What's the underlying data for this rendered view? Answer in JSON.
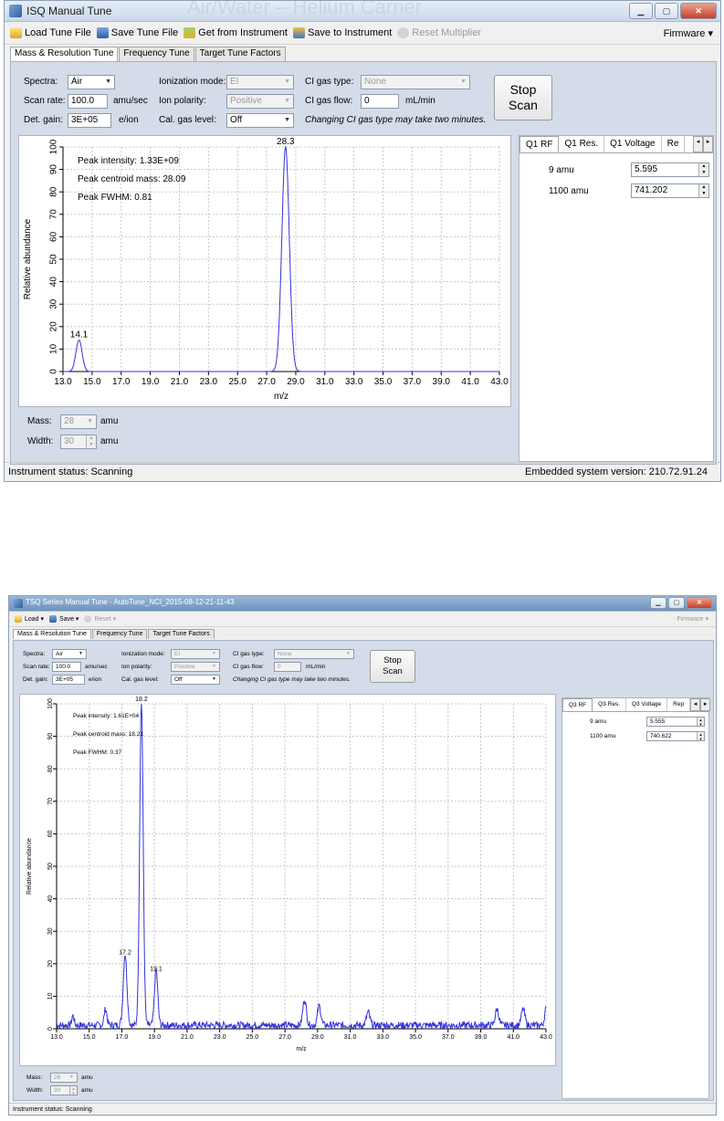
{
  "window1": {
    "title": "ISQ Manual Tune",
    "ghost_title": "Air/Water – Helium Carrier",
    "toolbar": {
      "load_label": "Load Tune File",
      "save_label": "Save Tune File",
      "get_label": "Get from Instrument",
      "save_instr_label": "Save to Instrument",
      "reset_label": "Reset Multiplier",
      "firmware_label": "Firmware ▾"
    },
    "tabs": [
      "Mass & Resolution Tune",
      "Frequency Tune",
      "Target Tune Factors"
    ],
    "controls": {
      "spectra_label": "Spectra:",
      "spectra_value": "Air",
      "scan_rate_label": "Scan rate:",
      "scan_rate_value": "100.0",
      "scan_rate_unit": "amu/sec",
      "det_gain_label": "Det. gain:",
      "det_gain_value": "3E+05",
      "det_gain_unit": "e/ion",
      "ion_mode_label": "Ionization mode:",
      "ion_mode_value": "EI",
      "ion_polarity_label": "Ion polarity:",
      "ion_polarity_value": "Positive",
      "cal_gas_label": "Cal. gas level:",
      "cal_gas_value": "Off",
      "ci_type_label": "CI gas type:",
      "ci_type_value": "None",
      "ci_flow_label": "CI gas flow:",
      "ci_flow_value": "0",
      "ci_flow_unit": "mL/min",
      "ci_note": "Changing CI gas type may take two minutes.",
      "stop_line1": "Stop",
      "stop_line2": "Scan"
    },
    "annotations": {
      "intensity": "Peak intensity: 1.33E+09",
      "centroid": "Peak centroid mass: 28.09",
      "fwhm": "Peak FWHM: 0.81"
    },
    "mass_label": "Mass:",
    "mass_value": "28",
    "mass_unit": "amu",
    "width_label": "Width:",
    "width_value": "30",
    "width_unit": "amu",
    "side": {
      "tabs": [
        "Q1 RF",
        "Q1 Res.",
        "Q1 Voltage",
        "Re"
      ],
      "rows": [
        {
          "label": "9 amu",
          "value": "5.595"
        },
        {
          "label": "1100 amu",
          "value": "741.202"
        }
      ]
    },
    "status_left": "Instrument status: Scanning",
    "status_right": "Embedded system version: 210.72.91.24"
  },
  "window2": {
    "title": "TSQ Series Manual Tune - AutoTune_NCI_2015-08-12-21-11-43",
    "toolbar": {
      "load_label": "Load ▾",
      "save_label": "Save ▾",
      "reset_label": "Reset ▾",
      "firmware_label": "Firmware ▾"
    },
    "tabs": [
      "Mass & Resolution Tune",
      "Frequency Tune",
      "Target Tune Factors"
    ],
    "controls": {
      "spectra_label": "Spectra:",
      "spectra_value": "Air",
      "scan_rate_label": "Scan rate:",
      "scan_rate_value": "100.0",
      "scan_rate_unit": "amu/sec",
      "det_gain_label": "Det. gain:",
      "det_gain_value": "3E+05",
      "det_gain_unit": "e/ion",
      "ion_mode_label": "Ionization mode:",
      "ion_mode_value": "EI",
      "ion_polarity_label": "Ion polarity:",
      "ion_polarity_value": "Positive",
      "cal_gas_label": "Cal. gas level:",
      "cal_gas_value": "Off",
      "ci_type_label": "CI gas type:",
      "ci_type_value": "None",
      "ci_flow_label": "CI gas flow:",
      "ci_flow_value": "0",
      "ci_flow_unit": "mL/min",
      "ci_note": "Changing CI gas type may take two minutes.",
      "stop_line1": "Stop",
      "stop_line2": "Scan"
    },
    "annotations": {
      "intensity": "Peak intensity: 1.61E+04",
      "centroid": "Peak centroid mass: 18.21",
      "fwhm": "Peak FWHM: 0.37"
    },
    "mass_label": "Mass:",
    "mass_value": "28",
    "mass_unit": "amu",
    "width_label": "Width:",
    "width_value": "30",
    "width_unit": "amu",
    "side": {
      "tabs": [
        "Q3 RF",
        "Q3 Res.",
        "Q3 Voltage",
        "Rep"
      ],
      "rows": [
        {
          "label": "9 amu",
          "value": "5.555"
        },
        {
          "label": "1100 amu",
          "value": "740.622"
        }
      ]
    },
    "status_left": "Instrument status: Scanning"
  },
  "colors": {
    "trace": "#3333dd",
    "panel": "#d3dce8",
    "grid": "#c8c8c8"
  },
  "chart_data": [
    {
      "type": "line",
      "xlabel": "m/z",
      "ylabel": "Relative abundance",
      "xlim": [
        13.0,
        43.0
      ],
      "ylim": [
        0,
        100
      ],
      "xticks": [
        "13.0",
        "15.0",
        "17.0",
        "19.0",
        "21.0",
        "23.0",
        "25.0",
        "27.0",
        "29.0",
        "31.0",
        "33.0",
        "35.0",
        "37.0",
        "39.0",
        "41.0",
        "43.0"
      ],
      "yticks": [
        "0",
        "10",
        "20",
        "30",
        "40",
        "50",
        "60",
        "70",
        "80",
        "90",
        "100"
      ],
      "peaks": [
        {
          "mz": 14.1,
          "height": 14,
          "width": 0.3
        },
        {
          "mz": 28.3,
          "height": 100,
          "width": 0.36
        }
      ],
      "peak_labels": [
        {
          "label": "14.1",
          "mz": 14.1,
          "y": 14
        },
        {
          "label": "28.3",
          "mz": 28.3,
          "y": 100
        }
      ]
    },
    {
      "type": "line",
      "xlabel": "m/z",
      "ylabel": "Relative abundance",
      "xlim": [
        13.0,
        43.0
      ],
      "ylim": [
        0,
        100
      ],
      "xticks": [
        "13.0",
        "15.0",
        "17.0",
        "19.0",
        "21.0",
        "23.0",
        "25.0",
        "27.0",
        "29.0",
        "31.0",
        "33.0",
        "35.0",
        "37.0",
        "39.0",
        "41.0",
        "43.0"
      ],
      "yticks": [
        "0",
        "10",
        "20",
        "30",
        "40",
        "50",
        "60",
        "70",
        "80",
        "90",
        "100"
      ],
      "peaks": [
        {
          "mz": 16.0,
          "height": 5,
          "width": 0.12
        },
        {
          "mz": 17.2,
          "height": 22,
          "width": 0.16
        },
        {
          "mz": 18.2,
          "height": 100,
          "width": 0.15
        },
        {
          "mz": 19.1,
          "height": 17,
          "width": 0.14
        },
        {
          "mz": 14.0,
          "height": 3,
          "width": 0.1
        },
        {
          "mz": 28.2,
          "height": 8,
          "width": 0.15
        },
        {
          "mz": 29.1,
          "height": 6,
          "width": 0.15
        },
        {
          "mz": 32.1,
          "height": 4,
          "width": 0.15
        },
        {
          "mz": 40.0,
          "height": 5,
          "width": 0.15
        },
        {
          "mz": 41.6,
          "height": 5,
          "width": 0.15
        },
        {
          "mz": 43.0,
          "height": 5,
          "width": 0.12
        }
      ],
      "peak_labels": [
        {
          "label": "17.2",
          "mz": 17.2,
          "y": 22
        },
        {
          "label": "18.2",
          "mz": 18.2,
          "y": 100
        },
        {
          "label": "19.1",
          "mz": 19.1,
          "y": 17
        }
      ]
    }
  ]
}
